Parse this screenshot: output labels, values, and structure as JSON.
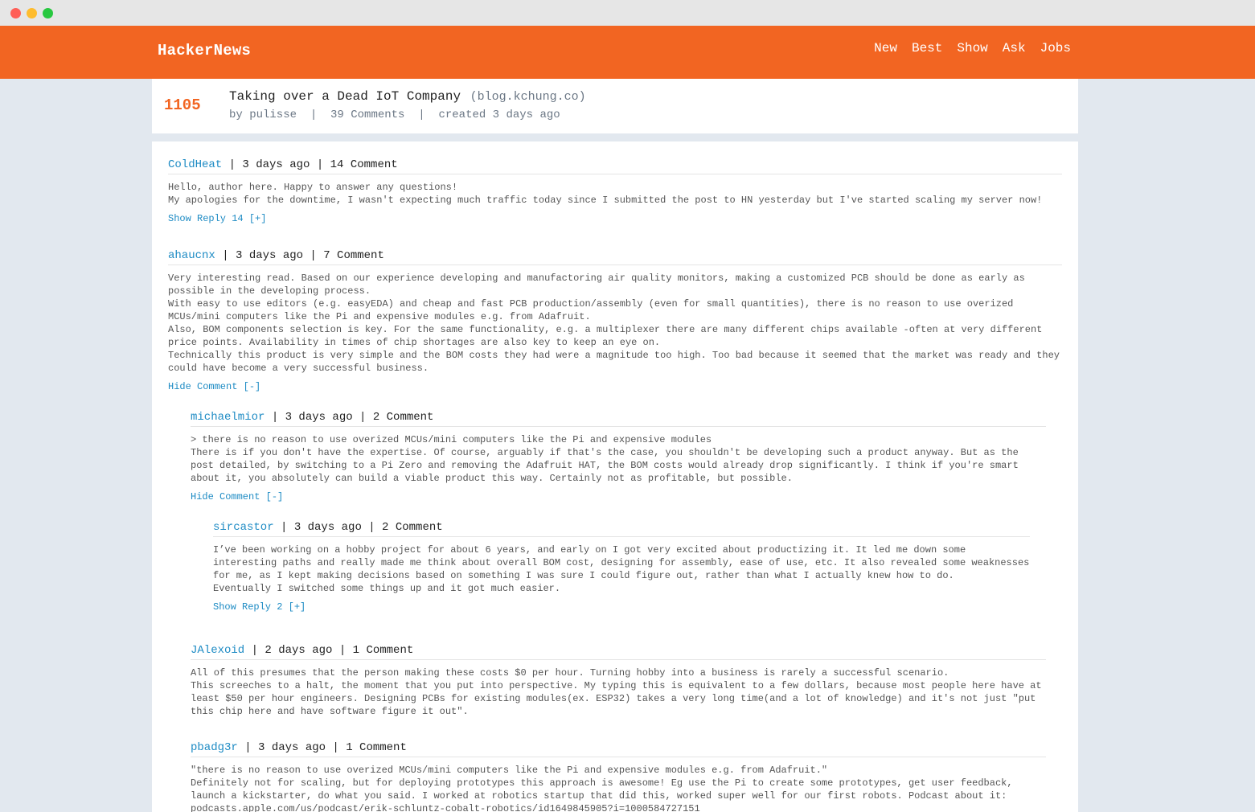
{
  "header": {
    "logo": "HackerNews",
    "nav": [
      "New",
      "Best",
      "Show",
      "Ask",
      "Jobs"
    ]
  },
  "story": {
    "score": "1105",
    "title": "Taking over a Dead IoT Company",
    "domain": "(blog.kchung.co)",
    "author": "by pulisse",
    "sep": "  |  ",
    "comments": "39 Comments",
    "created": "created 3 days ago"
  },
  "comments": [
    {
      "user": "ColdHeat",
      "meta": " | 3 days ago | 14 Comment",
      "body": "Hello, author here. Happy to answer any questions!\nMy apologies for the downtime, I wasn't expecting much traffic today since I submitted the post to HN yesterday but I've started scaling my server now!",
      "toggle": "Show Reply 14 [+]"
    },
    {
      "user": "ahaucnx",
      "meta": " | 3 days ago | 7 Comment",
      "body": "Very interesting read. Based on our experience developing and manufactoring air quality monitors, making a customized PCB should be done as early as\npossible in the developing process.\nWith easy to use editors (e.g. easyEDA) and cheap and fast PCB production/assembly (even for small quantities), there is no reason to use overized\nMCUs/mini computers like the Pi and expensive modules e.g. from Adafruit.\nAlso, BOM components selection is key. For the same functionality, e.g. a multiplexer there are many different chips available -often at very different\nprice points. Availability in times of chip shortages are also key to keep an eye on.\nTechnically this product is very simple and the BOM costs they had were a magnitude too high. Too bad because it seemed that the market was ready and they\ncould have become a very successful business.",
      "toggle": "Hide Comment [-]"
    },
    {
      "user": "michaelmior",
      "meta": " | 3 days ago | 2 Comment",
      "body": "> there is no reason to use overized MCUs/mini computers like the Pi and expensive modules\nThere is if you don't have the expertise. Of course, arguably if that's the case, you shouldn't be developing such a product anyway. But as the\npost detailed, by switching to a Pi Zero and removing the Adafruit HAT, the BOM costs would already drop significantly. I think if you're smart\nabout it, you absolutely can build a viable product this way. Certainly not as profitable, but possible.",
      "toggle": "Hide Comment [-]"
    },
    {
      "user": "sircastor",
      "meta": " | 3 days ago | 2 Comment",
      "body": "I’ve been working on a hobby project for about 6 years, and early on I got very excited about productizing it. It led me down some\ninteresting paths and really made me think about overall BOM cost, designing for assembly, ease of use, etc. It also revealed some weaknesses\nfor me, as I kept making decisions based on something I was sure I could figure out, rather than what I actually knew how to do.\nEventually I switched some things up and it got much easier.",
      "toggle": "Show Reply 2 [+]"
    },
    {
      "user": "JAlexoid",
      "meta": " | 2 days ago | 1 Comment",
      "body": "All of this presumes that the person making these costs $0 per hour. Turning hobby into a business is rarely a successful scenario.\nThis screeches to a halt, the moment that you put into perspective. My typing this is equivalent to a few dollars, because most people here have at\nleast $50 per hour engineers. Designing PCBs for existing modules(ex. ESP32) takes a very long time(and a lot of knowledge) and it's not just \"put\nthis chip here and have software figure it out\".",
      "toggle": ""
    },
    {
      "user": "pbadg3r",
      "meta": " | 3 days ago | 1 Comment",
      "body": "\"there is no reason to use overized MCUs/mini computers like the Pi and expensive modules e.g. from Adafruit.\"\nDefinitely not for scaling, but for deploying prototypes this approach is awesome! Eg use the Pi to create some prototypes, get user feedback,\nlaunch a kickstarter, do what you said. I worked at robotics startup that did this, worked super well for our first robots. Podcast about it:\npodcasts.apple.com/us/podcast/erik-schluntz-cobalt-robotics/id1649845905?i=1000584727151",
      "toggle": ""
    }
  ]
}
